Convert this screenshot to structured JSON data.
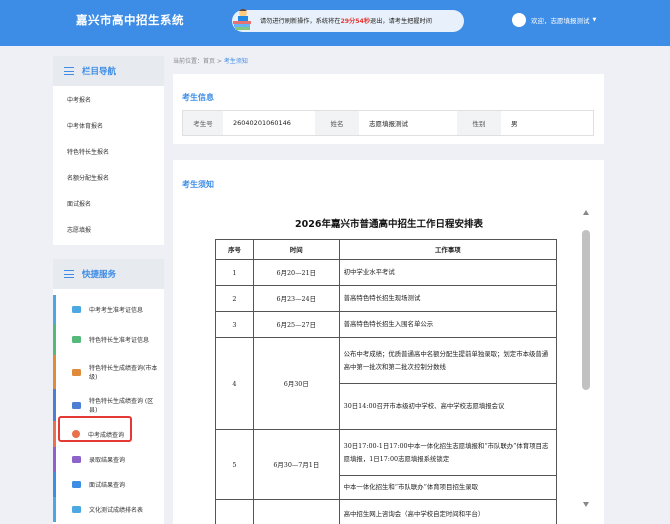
{
  "header": {
    "title": "嘉兴市高中招生系统",
    "notice": {
      "prefix": "请勿进行刷新操作，系统将在",
      "countdown": "29分54秒",
      "suffix": "退出，请考生把握时间"
    },
    "user_name": "欢迎，志愿填报测试"
  },
  "breadcrumb": {
    "prefix": "当前位置：首页 > ",
    "current": "考生须知"
  },
  "sidebar": {
    "nav_title": "栏目导航",
    "nav_items": [
      {
        "label": "中考报名"
      },
      {
        "label": "中考体育报名"
      },
      {
        "label": "特色特长生报名"
      },
      {
        "label": "名额分配生报名"
      },
      {
        "label": "面试报名"
      },
      {
        "label": "志愿填报"
      }
    ],
    "quick_title": "快捷服务",
    "quick_items": [
      {
        "label": "中考考生准考证信息",
        "color": "#4ca8e0"
      },
      {
        "label": "特色特长生准考证信息",
        "color": "#55b97a"
      },
      {
        "label": "特色特长生成绩查询(市本级)",
        "color": "#e08a3c"
      },
      {
        "label": "特色特长生成绩查询 (区县)",
        "color": "#4a7fd4"
      },
      {
        "label": "中考成绩查询",
        "color": "#e8704a"
      },
      {
        "label": "录取结果查询",
        "color": "#8e63c9"
      },
      {
        "label": "面试结果查询",
        "color": "#3d8ce6"
      },
      {
        "label": "文化测试成绩排名表",
        "color": "#4ca8e0"
      }
    ]
  },
  "student_info": {
    "title": "考生信息",
    "id_label": "考生号",
    "id_value": "26040201060146",
    "name_label": "姓名",
    "name_value": "志愿填报测试",
    "gender_label": "性别",
    "gender_value": "男"
  },
  "notice_section": {
    "title": "考生须知",
    "doc_title": "2026年嘉兴市普通高中招生工作日程安排表",
    "headers": [
      "序号",
      "时间",
      "工作事项"
    ],
    "rows": [
      {
        "no": "1",
        "time": "6月20—21日",
        "items": [
          "初中学业水平考试"
        ]
      },
      {
        "no": "2",
        "time": "6月23—24日",
        "items": [
          "普高特色特长招生现场测试"
        ]
      },
      {
        "no": "3",
        "time": "6月25—27日",
        "items": [
          "普高特色特长招生入围名单公示"
        ]
      },
      {
        "no": "4",
        "time": "6月30日",
        "items": [
          "公布中考成绩；优质普通高中名额分配生提前单独录取；划定市本级普通高中第一批次和第二批次控制分数线",
          "30日14:00召开市本级初中学校、高中学校志愿填报会议"
        ]
      },
      {
        "no": "5",
        "time": "6月30—7月1日",
        "items": [
          "30日17:00-1日17:00中本一体化招生志愿填报和“市队联办”体育项目志愿填报，1日17:00志愿填报系统锁定",
          "中本一体化招生和“市队联办”体育项目招生录取"
        ]
      },
      {
        "no": "",
        "time": "",
        "items": [
          "高中招生网上咨询会（高中学校自定时间和平台）"
        ]
      }
    ]
  },
  "colors": {
    "header_bg": "#3d8ce6",
    "accent": "#3d8ce6",
    "highlight": "#e53935",
    "countdown": "#e53935"
  }
}
